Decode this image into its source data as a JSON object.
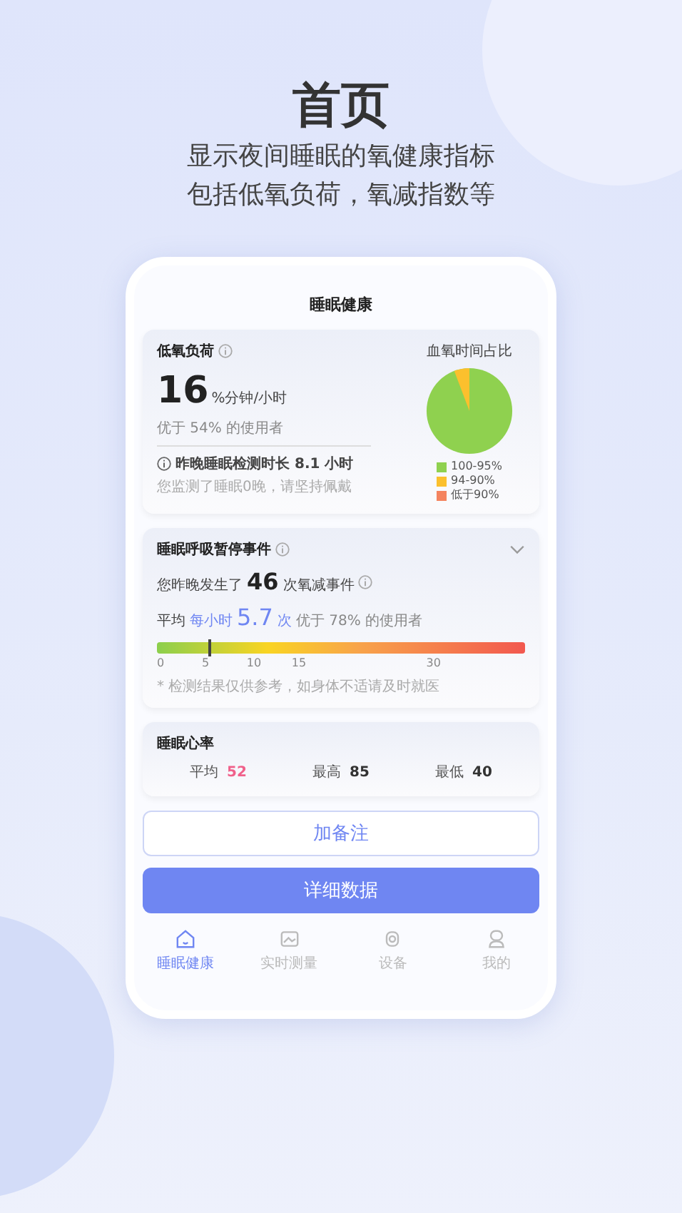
{
  "page": {
    "title": "首页",
    "subtitle_lines": [
      "显示夜间睡眠的氧健康指标",
      "包括低氧负荷，氧减指数等"
    ]
  },
  "screen": {
    "title": "睡眠健康",
    "hypoxic_card": {
      "title": "低氧负荷",
      "value": "16",
      "unit": "%分钟/小时",
      "comparison": "优于 54% 的使用者",
      "duration": "昨晚睡眠检测时长 8.1 小时",
      "hint": "您监测了睡眠0晚，请坚持佩戴",
      "chart_title": "血氧时间占比",
      "legend": [
        {
          "label": "100-95%",
          "color": "#8fd14f"
        },
        {
          "label": "94-90%",
          "color": "#fbc02d"
        },
        {
          "label": "低于90%",
          "color": "#f4845f"
        }
      ]
    },
    "apnea_card": {
      "title": "睡眠呼吸暂停事件",
      "events_prefix": "您昨晚发生了",
      "events_count": "46",
      "events_suffix": "次氧减事件",
      "rate_prefix": "平均",
      "rate_per": "每小时",
      "rate": "5.7",
      "rate_unit": "次",
      "rate_comparison": "优于 78% 的使用者",
      "gauge": {
        "level": 0.14,
        "ticks": [
          "0",
          "5",
          "10",
          "15",
          "30"
        ]
      },
      "note": "* 检测结果仅供参考，如身体不适请及时就医"
    },
    "heart_card": {
      "title": "睡眠心率",
      "stats": [
        {
          "label": "平均",
          "value": "52",
          "kind": "highlight"
        },
        {
          "label": "最高",
          "value": "85",
          "kind": "normal"
        },
        {
          "label": "最低",
          "value": "40",
          "kind": "normal"
        }
      ]
    },
    "buttons": [
      {
        "label": "加备注",
        "kind": "outline"
      },
      {
        "label": "详细数据",
        "kind": "primary"
      }
    ],
    "tabs": [
      {
        "label": "睡眠健康",
        "selected": true
      },
      {
        "label": "实时测量",
        "selected": false
      },
      {
        "label": "设备",
        "selected": false
      },
      {
        "label": "我的",
        "selected": false
      }
    ]
  }
}
